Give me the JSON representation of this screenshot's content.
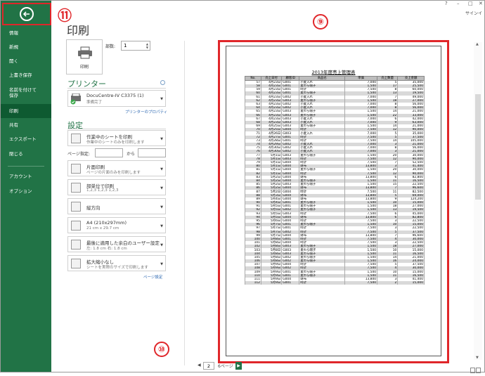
{
  "window": {
    "help": "?",
    "minimize": "–",
    "restore": "□",
    "close": "✕",
    "signin": "サインイ"
  },
  "sidebar": {
    "items": [
      {
        "label": "情報"
      },
      {
        "label": "新規"
      },
      {
        "label": "開く"
      },
      {
        "label": "上書き保存"
      },
      {
        "label": "名前を付けて\n保存"
      },
      {
        "label": "印刷"
      },
      {
        "label": "共有"
      },
      {
        "label": "エクスポート"
      },
      {
        "label": "閉じる"
      },
      {
        "label": "アカウント"
      },
      {
        "label": "オプション"
      }
    ]
  },
  "panel": {
    "title": "印刷",
    "print_button": "印刷",
    "copies_label": "部数:",
    "copies_value": "1",
    "printer_header": "プリンター",
    "printer_name": "DocuCentre-IV C3375 (1)",
    "printer_status": "準備完了",
    "printer_properties": "プリンターのプロパティ",
    "settings_header": "設定",
    "settings": [
      {
        "l1": "作業中のシートを印刷",
        "l2": "作業中のシートのみを印刷します"
      },
      {
        "l1": "片面印刷",
        "l2": "ページの片面のみを印刷します"
      },
      {
        "l1": "部単位で印刷",
        "l2": "1,2,3    1,2,3    1,2,3"
      },
      {
        "l1": "縦方向",
        "l2": ""
      },
      {
        "l1": "A4 (210x297mm)",
        "l2": "21 cm x 29.7 cm"
      },
      {
        "l1": "最後に適用した余白のユーザー設定",
        "l2": "左:  1.8 cm    右:  1.8 cm"
      },
      {
        "l1": "拡大縮小なし",
        "l2": "シートを実際のサイズで印刷します"
      }
    ],
    "pages_label": "ページ指定:",
    "to_label": "から",
    "page_setup": "ページ設定"
  },
  "preview": {
    "doc_title": "2013年度売上管理表",
    "headers": [
      "No.",
      "売上日付",
      "顧客ID",
      "商品名",
      "単価",
      "売上数量",
      "売上金額"
    ],
    "rows": [
      [
        "57",
        "4月23日",
        "G001",
        "小麦入れ",
        "7,000",
        "5",
        "35,000"
      ],
      [
        "58",
        "4月23日",
        "G001",
        "麦わら帽子",
        "1,500",
        "17",
        "25,500"
      ],
      [
        "59",
        "4月23日",
        "G001",
        "時計",
        "7,500",
        "8",
        "60,000"
      ],
      [
        "60",
        "4月23日",
        "G001",
        "麦わら帽子",
        "1,500",
        "13",
        "19,500"
      ],
      [
        "61",
        "4月23日",
        "G002",
        "小麦入れ",
        "7,000",
        "7",
        "49,000"
      ],
      [
        "62",
        "4月23日",
        "G003",
        "麦わら帽子",
        "1,500",
        "18",
        "27,000"
      ],
      [
        "63",
        "4月23日",
        "G002",
        "小麦入れ",
        "7,000",
        "8",
        "56,000"
      ],
      [
        "64",
        "4月23日",
        "G002",
        "小麦入れ",
        "7,000",
        "8",
        "56,000"
      ],
      [
        "65",
        "4月23日",
        "G003",
        "麦わら帽子",
        "1,500",
        "14",
        "21,000"
      ],
      [
        "66",
        "4月23日",
        "G003",
        "麦わら帽子",
        "1,500",
        "22",
        "33,000"
      ],
      [
        "67",
        "4月23日",
        "G003",
        "小麦入れ",
        "7,000",
        "6",
        "42,000"
      ],
      [
        "68",
        "4月23日",
        "G003",
        "小麦入れ",
        "7,000",
        "9",
        "63,000"
      ],
      [
        "69",
        "4月25日",
        "G003",
        "麦わら帽子",
        "1,500",
        "14",
        "21,000"
      ],
      [
        "70",
        "4月25日",
        "G004",
        "時計",
        "7,500",
        "12",
        "90,000"
      ],
      [
        "71",
        "4月26日",
        "G003",
        "小麦入れ",
        "7,000",
        "5",
        "35,000"
      ],
      [
        "72",
        "4月27日",
        "G001",
        "時計",
        "7,500",
        "5",
        "37,500"
      ],
      [
        "73",
        "4月28日",
        "G001",
        "時計",
        "7,500",
        "14",
        "105,000"
      ],
      [
        "74",
        "4月29日",
        "G002",
        "小麦入れ",
        "7,000",
        "3",
        "21,000"
      ],
      [
        "75",
        "4月30日",
        "G002",
        "小麦入れ",
        "7,000",
        "8",
        "56,000"
      ],
      [
        "76",
        "4月30日",
        "G002",
        "小麦入れ",
        "7,000",
        "3",
        "21,000"
      ],
      [
        "77",
        "5月1日",
        "G003",
        "麦わら帽子",
        "1,500",
        "20",
        "30,000"
      ],
      [
        "78",
        "5月1日",
        "G003",
        "時計",
        "7,500",
        "12",
        "90,000"
      ],
      [
        "79",
        "5月1日",
        "G004",
        "時計",
        "7,500",
        "7",
        "52,500"
      ],
      [
        "80",
        "5月1日",
        "G004",
        "財布",
        "13,800",
        "3",
        "41,400"
      ],
      [
        "81",
        "5月1日",
        "G004",
        "麦わら帽子",
        "1,500",
        "20",
        "30,000"
      ],
      [
        "82",
        "5月1日",
        "G004",
        "時計",
        "7,500",
        "12",
        "90,000"
      ],
      [
        "83",
        "5月2日",
        "G004",
        "財布",
        "13,800",
        "6",
        "82,800"
      ],
      [
        "84",
        "5月2日",
        "G004",
        "麦わら帽子",
        "1,500",
        "11",
        "16,500"
      ],
      [
        "85",
        "5月2日",
        "G003",
        "麦わら帽子",
        "1,500",
        "15",
        "22,500"
      ],
      [
        "86",
        "5月2日",
        "G004",
        "財布",
        "13,800",
        "7",
        "96,600"
      ],
      [
        "87",
        "5月2日",
        "G004",
        "時計",
        "7,500",
        "11",
        "82,500"
      ],
      [
        "88",
        "5月3日",
        "G004",
        "財布",
        "13,800",
        "5",
        "69,000"
      ],
      [
        "89",
        "5月4日",
        "G004",
        "財布",
        "13,800",
        "9",
        "124,200"
      ],
      [
        "90",
        "5月4日",
        "G001",
        "麦わら帽子",
        "1,500",
        "10",
        "15,000"
      ],
      [
        "91",
        "5月5日",
        "G001",
        "麦わら帽子",
        "1,500",
        "18",
        "27,000"
      ],
      [
        "92",
        "5月5日",
        "G002",
        "麦わら帽子",
        "1,500",
        "13",
        "19,500"
      ],
      [
        "93",
        "5月5日",
        "G003",
        "時計",
        "7,500",
        "6",
        "45,000"
      ],
      [
        "94",
        "5月5日",
        "G004",
        "財布",
        "13,800",
        "6",
        "82,800"
      ],
      [
        "95",
        "5月6日",
        "G004",
        "時計",
        "7,500",
        "3",
        "22,500"
      ],
      [
        "96",
        "5月7日",
        "G001",
        "麦わら帽子",
        "1,500",
        "10",
        "15,000"
      ],
      [
        "97",
        "5月7日",
        "G001",
        "時計",
        "7,500",
        "3",
        "22,500"
      ],
      [
        "98",
        "5月7日",
        "G002",
        "時計",
        "7,500",
        "5",
        "37,500"
      ],
      [
        "99",
        "5月7日",
        "G004",
        "財布",
        "13,800",
        "7",
        "96,600"
      ],
      [
        "100",
        "5月8日",
        "G001",
        "時計",
        "7,500",
        "4",
        "30,000"
      ],
      [
        "101",
        "5月8日",
        "G004",
        "時計",
        "7,500",
        "3",
        "22,500"
      ],
      [
        "102",
        "5月8日",
        "G003",
        "麦わら帽子",
        "1,500",
        "18",
        "27,000"
      ],
      [
        "103",
        "5月8日",
        "G003",
        "麦わら帽子",
        "1,500",
        "10",
        "15,000"
      ],
      [
        "104",
        "5月8日",
        "G003",
        "麦わら帽子",
        "1,500",
        "11",
        "16,500"
      ],
      [
        "105",
        "5月8日",
        "G002",
        "麦わら帽子",
        "1,500",
        "14",
        "21,000"
      ],
      [
        "106",
        "5月8日",
        "G002",
        "麦わら帽子",
        "1,500",
        "16",
        "24,000"
      ],
      [
        "107",
        "5月9日",
        "G004",
        "時計",
        "7,500",
        "5",
        "37,500"
      ],
      [
        "108",
        "5月9日",
        "G002",
        "時計",
        "7,500",
        "4",
        "30,000"
      ],
      [
        "109",
        "5月9日",
        "G001",
        "麦わら帽子",
        "1,500",
        "10",
        "15,000"
      ],
      [
        "110",
        "5月9日",
        "G001",
        "麦わら帽子",
        "1,500",
        "11",
        "16,500"
      ],
      [
        "111",
        "5月9日",
        "G004",
        "財布",
        "13,800",
        "3",
        "41,400"
      ],
      [
        "112",
        "5月9日",
        "G001",
        "時計",
        "7,500",
        "2",
        "15,000"
      ]
    ]
  },
  "pager": {
    "current": "2",
    "total": "6ページ",
    "prev": "◀",
    "next": "▶"
  },
  "annotations": {
    "back": "⑪",
    "preview": "⑨",
    "pager": "⑩"
  },
  "colors": {
    "accent": "#217346",
    "annotation": "#e0262a"
  }
}
